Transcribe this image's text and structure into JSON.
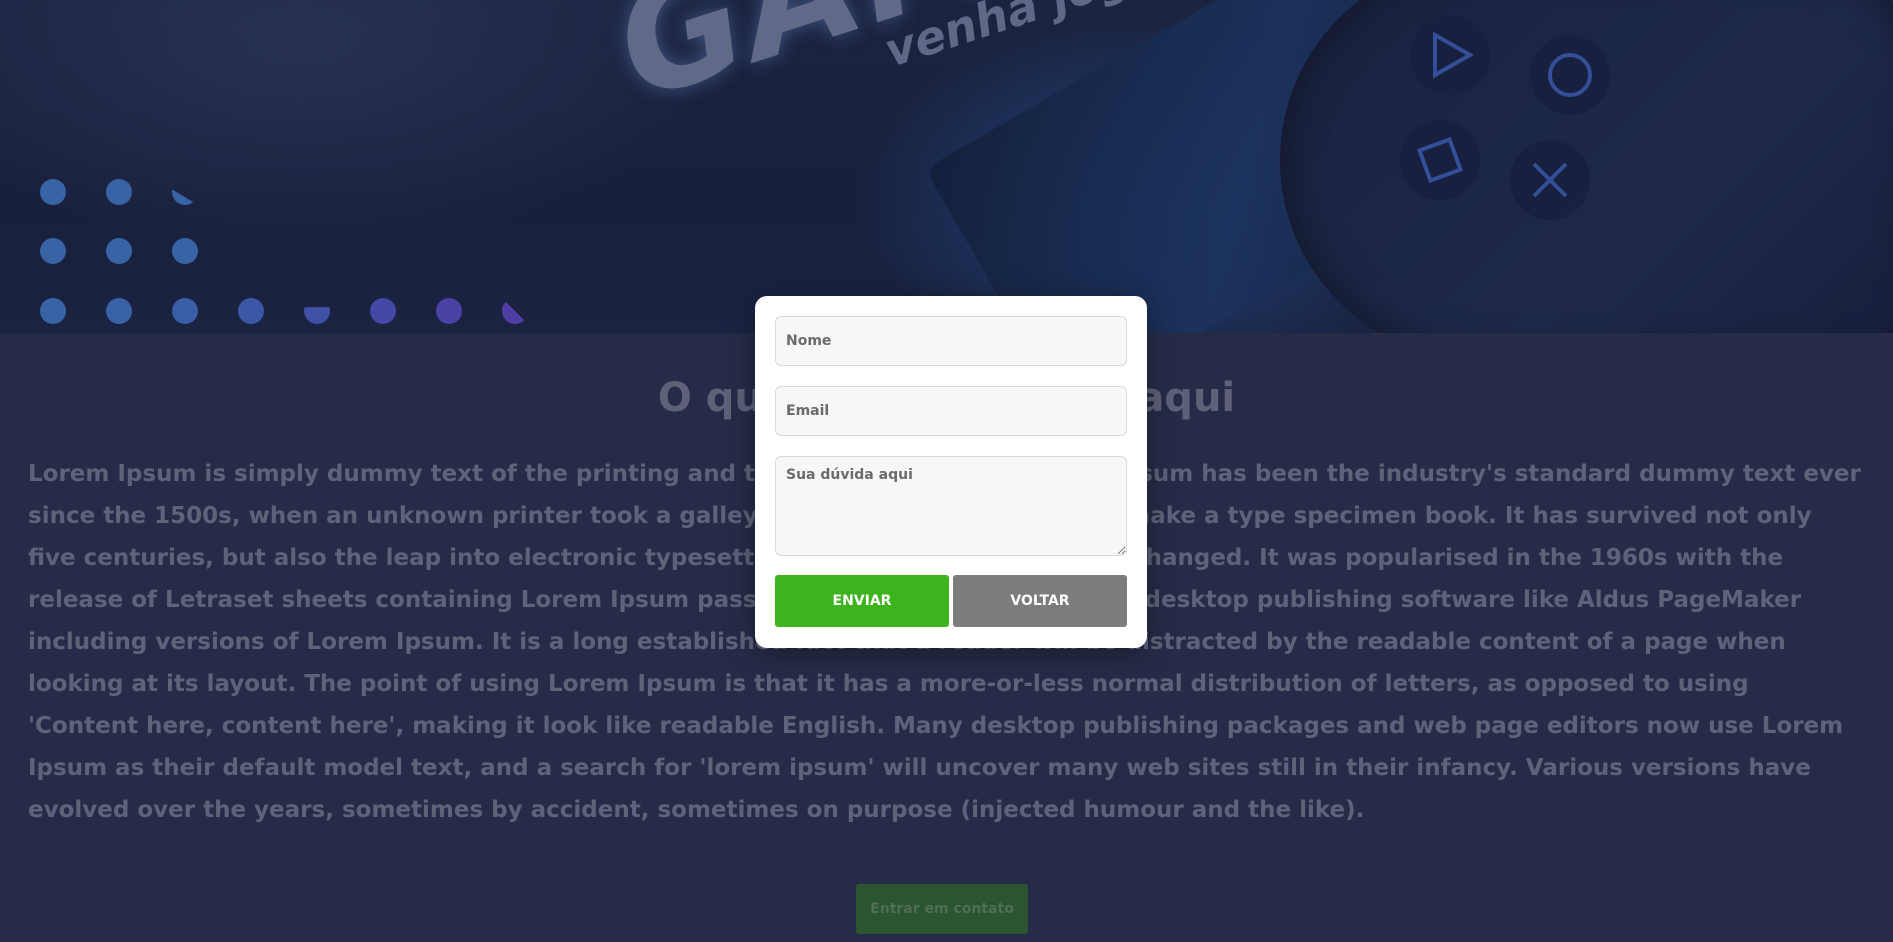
{
  "hero": {
    "logo_text": "GAMES",
    "tagline": "venha jogar com"
  },
  "main": {
    "title": "O que voce encontra aqui",
    "body": "Lorem Ipsum is simply dummy text of the printing and typesetting industry. Lorem Ipsum has been the industry's standard dummy text ever since the 1500s, when an unknown printer took a galley of type and scrambled it to make a type specimen book. It has survived not only five centuries, but also the leap into electronic typesetting, remaining essentially unchanged. It was popularised in the 1960s with the release of Letraset sheets containing Lorem Ipsum passages, and more recently with desktop publishing software like Aldus PageMaker including versions of Lorem Ipsum. It is a long established fact that a reader will be distracted by the readable content of a page when looking at its layout. The point of using Lorem Ipsum is that it has a more-or-less normal distribution of letters, as opposed to using 'Content here, content here', making it look like readable English. Many desktop publishing packages and web page editors now use Lorem Ipsum as their default model text, and a search for 'lorem ipsum' will uncover many web sites still in their infancy. Various versions have evolved over the years, sometimes by accident, sometimes on purpose (injected humour and the like).",
    "contact_button": "Entrar em contato"
  },
  "modal": {
    "name_placeholder": "Nome",
    "email_placeholder": "Email",
    "message_placeholder": "Sua dúvida aqui",
    "submit_label": "ENVIAR",
    "back_label": "VOLTAR"
  },
  "colors": {
    "submit": "#3db41e",
    "back": "#7c7c7c",
    "contact": "#2f5d32"
  }
}
